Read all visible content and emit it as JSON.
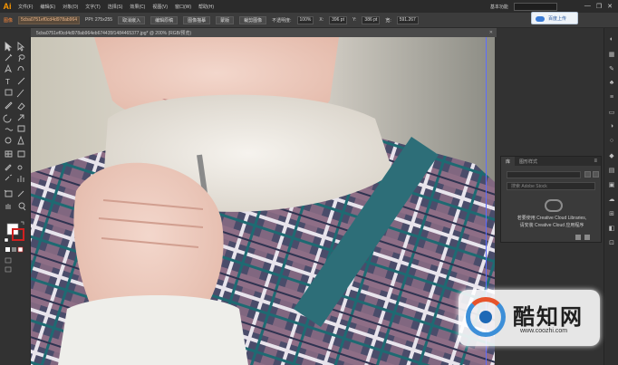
{
  "app": {
    "logo": "Ai"
  },
  "menu": {
    "items": [
      "文件(F)",
      "编辑(E)",
      "对象(O)",
      "文字(T)",
      "选择(S)",
      "效果(C)",
      "视图(V)",
      "窗口(W)",
      "帮助(H)"
    ],
    "workspace": "基本功能",
    "window_buttons": [
      "—",
      "❐",
      "✕"
    ]
  },
  "control": {
    "label": "图像",
    "file_name": "5cba0751ef0cd4d978ab964",
    "ppi": "PPI: 275x255",
    "btn_embed": "取消嵌入",
    "btn_edit": "编辑原稿",
    "btn_trace": "图像描摹",
    "btn_mask": "蒙版",
    "btn_crop": "裁剪图像",
    "opacity_label": "不透明度:",
    "opacity": "100%",
    "x_label": "X:",
    "x_value": "396 pt",
    "y_label": "Y:",
    "y_value": "386 pt",
    "w_label": "宽:",
    "w_value": "591.267"
  },
  "cloud_popup": {
    "label": "百度上传"
  },
  "document": {
    "tab_title": "5cba0751ef0cd4d978ab964eb674435f1484465377.jpg* @ 200% (RGB/预览)",
    "close": "✕"
  },
  "panel": {
    "tabs": [
      "库",
      "图形样式"
    ],
    "menu_icon": "≡",
    "search_placeholder": "搜索 Adobe Stock",
    "message_line1": "若要使用 Creative Cloud Libraries,",
    "message_line2": "请安装 Creative Cloud 应用程序"
  },
  "watermark": {
    "brand": "酷知网",
    "url": "www.coozhi.com"
  },
  "colors": {
    "accent": "#ff9a00",
    "artboard_border": "#5c6cff"
  }
}
